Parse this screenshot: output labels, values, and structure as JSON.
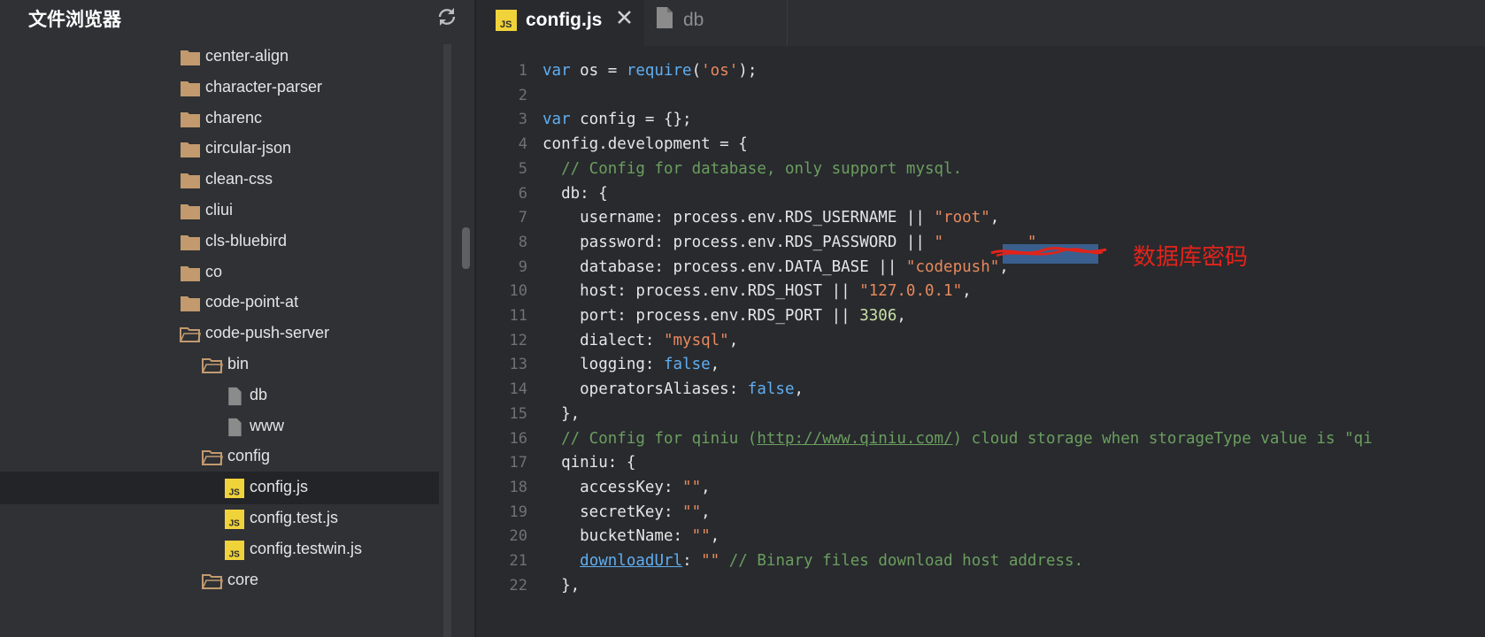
{
  "sidebar": {
    "title": "文件浏览器",
    "refresh_icon": "refresh-icon",
    "tree": [
      {
        "label": "center-align",
        "type": "folder",
        "depth": 0,
        "open": false
      },
      {
        "label": "character-parser",
        "type": "folder",
        "depth": 0,
        "open": false
      },
      {
        "label": "charenc",
        "type": "folder",
        "depth": 0,
        "open": false
      },
      {
        "label": "circular-json",
        "type": "folder",
        "depth": 0,
        "open": false
      },
      {
        "label": "clean-css",
        "type": "folder",
        "depth": 0,
        "open": false
      },
      {
        "label": "cliui",
        "type": "folder",
        "depth": 0,
        "open": false
      },
      {
        "label": "cls-bluebird",
        "type": "folder",
        "depth": 0,
        "open": false
      },
      {
        "label": "co",
        "type": "folder",
        "depth": 0,
        "open": false
      },
      {
        "label": "code-point-at",
        "type": "folder",
        "depth": 0,
        "open": false
      },
      {
        "label": "code-push-server",
        "type": "folder",
        "depth": 0,
        "open": true
      },
      {
        "label": "bin",
        "type": "folder",
        "depth": 1,
        "open": true
      },
      {
        "label": "db",
        "type": "file",
        "depth": 2
      },
      {
        "label": "www",
        "type": "file",
        "depth": 2
      },
      {
        "label": "config",
        "type": "folder",
        "depth": 1,
        "open": true
      },
      {
        "label": "config.js",
        "type": "js",
        "depth": 2,
        "selected": true
      },
      {
        "label": "config.test.js",
        "type": "js",
        "depth": 2
      },
      {
        "label": "config.testwin.js",
        "type": "js",
        "depth": 2
      },
      {
        "label": "core",
        "type": "folder",
        "depth": 1,
        "open": true
      }
    ]
  },
  "tabs": [
    {
      "label": "config.js",
      "icon": "js-file-icon",
      "active": true
    },
    {
      "label": "db",
      "icon": "file-icon",
      "active": false
    }
  ],
  "js_badge": "JS",
  "annotation": "数据库密码",
  "editor": {
    "lines": [
      {
        "n": "1",
        "tokens": [
          [
            "kw",
            "var"
          ],
          [
            "t",
            " os = "
          ],
          [
            "kw",
            "require"
          ],
          [
            "t",
            "("
          ],
          [
            "str",
            "'os'"
          ],
          [
            "t",
            ");"
          ]
        ]
      },
      {
        "n": "2",
        "tokens": []
      },
      {
        "n": "3",
        "tokens": [
          [
            "kw",
            "var"
          ],
          [
            "t",
            " config = {};"
          ]
        ]
      },
      {
        "n": "4",
        "tokens": [
          [
            "t",
            "config.development = {"
          ]
        ]
      },
      {
        "n": "5",
        "tokens": [
          [
            "t",
            "  "
          ],
          [
            "cmt",
            "// Config for database, only support mysql."
          ]
        ]
      },
      {
        "n": "6",
        "tokens": [
          [
            "t",
            "  db: {"
          ]
        ]
      },
      {
        "n": "7",
        "tokens": [
          [
            "t",
            "    username: process.env.RDS_USERNAME || "
          ],
          [
            "str",
            "\"root\""
          ],
          [
            "t",
            ","
          ]
        ]
      },
      {
        "n": "8",
        "tokens": [
          [
            "t",
            "    password: process.env.RDS_PASSWORD || "
          ],
          [
            "str",
            "\""
          ],
          [
            "t",
            "         "
          ],
          [
            "str",
            "\""
          ],
          [
            "t",
            ","
          ]
        ]
      },
      {
        "n": "9",
        "tokens": [
          [
            "t",
            "    database: process.env.DATA_BASE || "
          ],
          [
            "str",
            "\"codepush\""
          ],
          [
            "t",
            ","
          ]
        ]
      },
      {
        "n": "10",
        "tokens": [
          [
            "t",
            "    host: process.env.RDS_HOST || "
          ],
          [
            "str",
            "\"127.0.0.1\""
          ],
          [
            "t",
            ","
          ]
        ]
      },
      {
        "n": "11",
        "tokens": [
          [
            "t",
            "    port: process.env.RDS_PORT || "
          ],
          [
            "num",
            "3306"
          ],
          [
            "t",
            ","
          ]
        ]
      },
      {
        "n": "12",
        "tokens": [
          [
            "t",
            "    dialect: "
          ],
          [
            "str",
            "\"mysql\""
          ],
          [
            "t",
            ","
          ]
        ]
      },
      {
        "n": "13",
        "tokens": [
          [
            "t",
            "    logging: "
          ],
          [
            "kw",
            "false"
          ],
          [
            "t",
            ","
          ]
        ]
      },
      {
        "n": "14",
        "tokens": [
          [
            "t",
            "    operatorsAliases: "
          ],
          [
            "kw",
            "false"
          ],
          [
            "t",
            ","
          ]
        ]
      },
      {
        "n": "15",
        "tokens": [
          [
            "t",
            "  },"
          ]
        ]
      },
      {
        "n": "16",
        "tokens": [
          [
            "t",
            "  "
          ],
          [
            "cmt",
            "// Config for qiniu ("
          ],
          [
            "url",
            "http://www.qiniu.com/"
          ],
          [
            "cmt",
            ") cloud storage when storageType value is \"qi"
          ]
        ]
      },
      {
        "n": "17",
        "tokens": [
          [
            "t",
            "  qiniu: {"
          ]
        ]
      },
      {
        "n": "18",
        "tokens": [
          [
            "t",
            "    accessKey: "
          ],
          [
            "str",
            "\"\""
          ],
          [
            "t",
            ","
          ]
        ]
      },
      {
        "n": "19",
        "tokens": [
          [
            "t",
            "    secretKey: "
          ],
          [
            "str",
            "\"\""
          ],
          [
            "t",
            ","
          ]
        ]
      },
      {
        "n": "20",
        "tokens": [
          [
            "t",
            "    bucketName: "
          ],
          [
            "str",
            "\"\""
          ],
          [
            "t",
            ","
          ]
        ]
      },
      {
        "n": "21",
        "tokens": [
          [
            "t",
            "    "
          ],
          [
            "link",
            "downloadUrl"
          ],
          [
            "t",
            ": "
          ],
          [
            "str",
            "\"\""
          ],
          [
            "t",
            " "
          ],
          [
            "cmt",
            "// Binary files download host address."
          ]
        ]
      },
      {
        "n": "22",
        "tokens": [
          [
            "t",
            "  },"
          ]
        ]
      }
    ]
  },
  "colors": {
    "folder": "#c29a6e",
    "js_badge_bg": "#f0d33b",
    "file": "#8b8b8b",
    "annotation": "#e2231a"
  }
}
